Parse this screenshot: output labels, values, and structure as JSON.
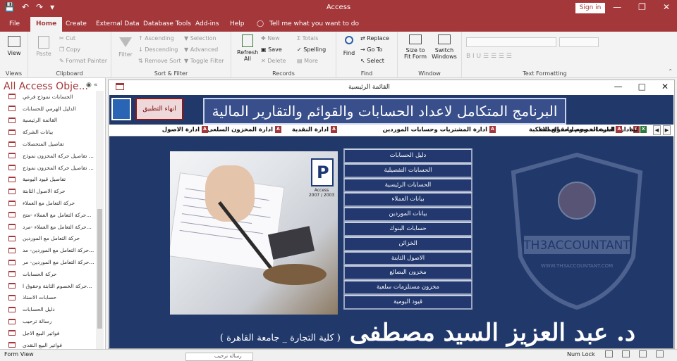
{
  "app": {
    "title": "Access",
    "sign_in": "Sign in"
  },
  "menu": {
    "items": [
      "File",
      "Home",
      "Create",
      "External Data",
      "Database Tools",
      "Add-ins",
      "Help"
    ],
    "tell_me": "Tell me what you want to do"
  },
  "ribbon": {
    "views": {
      "view": "View",
      "label": "Views"
    },
    "clipboard": {
      "paste": "Paste",
      "cut": "Cut",
      "copy": "Copy",
      "format_painter": "Format Painter",
      "label": "Clipboard"
    },
    "sort": {
      "filter": "Filter",
      "ascending": "Ascending",
      "descending": "Descending",
      "remove_sort": "Remove Sort",
      "selection": "Selection",
      "advanced": "Advanced",
      "toggle_filter": "Toggle Filter",
      "label": "Sort & Filter"
    },
    "records": {
      "refresh_all": "Refresh All",
      "new": "New",
      "save": "Save",
      "delete": "Delete",
      "totals": "Totals",
      "spelling": "Spelling",
      "more": "More",
      "label": "Records"
    },
    "find": {
      "find": "Find",
      "replace": "Replace",
      "goto": "Go To",
      "select": "Select",
      "label": "Find"
    },
    "window": {
      "size_to_fit": "Size to Fit Form",
      "switch_windows": "Switch Windows",
      "label": "Window"
    },
    "text": {
      "label": "Text Formatting"
    }
  },
  "nav_pane": {
    "title": "All Access Obje...",
    "items": [
      "الحسابات نموذج فرعي",
      "الدليل الهرمي للحسابات",
      "القائمة الرئيسية",
      "بيانات الشركة",
      "تفاصيل المتحصلات",
      "تفاصيل حركة المخزون نموذج ...",
      "تفاصيل حركة المخزون نموذج ...",
      "تفاصيل قيود اليومية",
      "حركة الاصول الثابتة",
      "حركة التعامل مع العملاء",
      "حركة التعامل مع العملاء -متح...",
      "حركة التعامل مع العملاء -مرد...",
      "حركة التعامل مع الموردين",
      "حركة التعامل مع الموردين- مد...",
      "حركة التعامل مع الموردين- مر...",
      "حركة الحسابات",
      "حركة الخصوم الثابتة وحقوق ا...",
      "حسابات الاستاذ",
      "دليل الحسابات",
      "رسالة ترحيب",
      "فواتير البيع الاجل",
      "فواتير البيع النقدى"
    ]
  },
  "form": {
    "window_title": "القائمة الرئيسية",
    "banner": "البرنامج المتكامل لاعداد الحسابات والقوائم والتقارير المالية",
    "exit_button": "انهاء التطبيق",
    "tabs": [
      "ادارة المبيعات وحسابات العملاء",
      "ادارة المشتريات وحسابات الموردين",
      "ادارة النقدية",
      "ادارة المخزون السلعى",
      "ادارة الاصول",
      "ادارة الخصوم وحقوق الملكية",
      "لية"
    ],
    "menu_buttons": [
      "دليل الحسابات",
      "الحسابات التفصيلية",
      "الحسابات الرئيسية",
      "بيانات العملاء",
      "بيانات الموردين",
      "حسابات البنوك",
      "الخزائن",
      "الاصول الثابتة",
      "مخزون البضائع",
      "مخزون مستلزمات سلعية",
      "قيود اليومية"
    ],
    "logo_text": "Access\n2007 / 2003",
    "watermark_text": "TH3ACCOUNTANT",
    "watermark_url": "WWW.TH3ACCOUNTANT.COM",
    "author_name": "د. عبد العزيز السيد مصطفى",
    "author_affil": "( كلية التجارة _ جامعة القاهرة )"
  },
  "status": {
    "view": "Form View",
    "tooltip": "رسالة ترحيب",
    "num_lock": "Num Lock"
  },
  "colors": {
    "accent": "#a4373a",
    "form_bg": "#21386b",
    "banner_bg": "#394f8c"
  }
}
